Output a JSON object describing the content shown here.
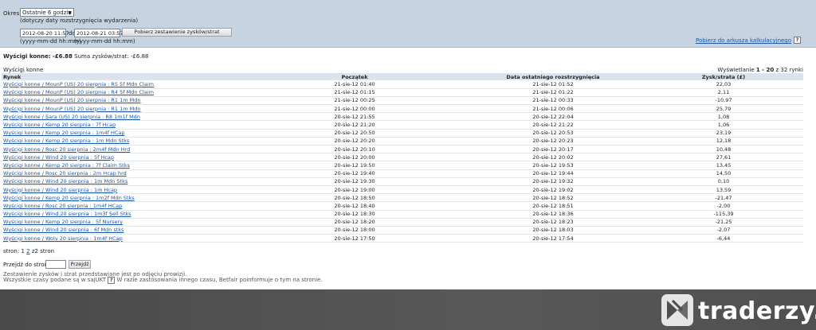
{
  "filter": {
    "period_label": "Okres:",
    "period_value": "Ostatnie 6 godzin",
    "period_note": "(dotyczy daty rozstrzygnięcia wydarzenia)",
    "from_value": "2012-08-20 11:57",
    "to_label": "do",
    "to_value": "2012-08-21 03:57",
    "format_hint_from": "(yyyy-mm-dd hh:mm)",
    "format_hint_to": "(yyyy-mm-dd hh:mm)",
    "fetch_button": "Pobierz zestawienie zysków/strat",
    "download_link": "Pobierz do arkusza kalkulacyjnego",
    "help": "?"
  },
  "summary": {
    "title": "Wyścigi konne:",
    "total": "-£6.88",
    "sum_label": "Suma zysków/strat:",
    "sum_value": "-£6.88"
  },
  "section": {
    "name": "Wyścigi konne",
    "showing_prefix": "Wyświetlanie",
    "showing_range": "1 - 20",
    "showing_suffix": "z 32 rynki"
  },
  "table": {
    "headers": {
      "market": "Rynek",
      "start": "Początek",
      "settled": "Data ostatniego rozstrzygnięcia",
      "pl": "Zysk/strata (£)"
    },
    "rows": [
      {
        "market": "Wyścigi konne / MounP (US) 20 sierpnia : R5 5f Mdn Claim",
        "start": "21-sie-12 01:40",
        "settled": "21-sie-12 01:52",
        "pl": "22,03"
      },
      {
        "market": "Wyścigi konne / MounP (US) 20 sierpnia : R4 5f Mdn Claim",
        "start": "21-sie-12 01:15",
        "settled": "21-sie-12 01:22",
        "pl": "2,11"
      },
      {
        "market": "Wyścigi konne / MounP (US) 20 sierpnia : R1 1m Mdn",
        "start": "21-sie-12 00:25",
        "settled": "21-sie-12 00:33",
        "pl": "-10,97"
      },
      {
        "market": "Wyścigi konne / MounP (US) 20 sierpnia : R1 1m Mdn",
        "start": "21-sie-12 00:00",
        "settled": "21-sie-12 00:06",
        "pl": "25,79"
      },
      {
        "market": "Wyścigi konne / Sara (US) 20 sierpnia : R8 1m1f Mdn",
        "start": "20-sie-12 21:55",
        "settled": "20-sie-12 22:04",
        "pl": "1,08"
      },
      {
        "market": "Wyścigi konne / Kemp 20 sierpnia : 7f Hcap",
        "start": "20-sie-12 21:20",
        "settled": "20-sie-12 21:22",
        "pl": "1,06"
      },
      {
        "market": "Wyścigi konne / Kemp 20 sierpnia : 1m4f HCap",
        "start": "20-sie-12 20:50",
        "settled": "20-sie-12 20:53",
        "pl": "23,19"
      },
      {
        "market": "Wyścigi konne / Kemp 20 sierpnia : 1m Mdn Stks",
        "start": "20-sie-12 20:20",
        "settled": "20-sie-12 20:23",
        "pl": "12,18"
      },
      {
        "market": "Wyścigi konne / Rosc 20 sierpnia : 2m4f Mdn Hrd",
        "start": "20-sie-12 20:10",
        "settled": "20-sie-12 20:17",
        "pl": "10,48"
      },
      {
        "market": "Wyścigi konne / Wind 20 sierpnia : 5f Hcap",
        "start": "20-sie-12 20:00",
        "settled": "20-sie-12 20:02",
        "pl": "27,61"
      },
      {
        "market": "Wyścigi konne / Kemp 20 sierpnia : 7f Claim Stks",
        "start": "20-sie-12 19:50",
        "settled": "20-sie-12 19:53",
        "pl": "13,45"
      },
      {
        "market": "Wyścigi konne / Rosc 20 sierpnia : 2m Hcap hrd",
        "start": "20-sie-12 19:40",
        "settled": "20-sie-12 19:44",
        "pl": "14,50"
      },
      {
        "market": "Wyścigi konne / Wind 20 sierpnia : 1m Mdn Stks",
        "start": "20-sie-12 19:30",
        "settled": "20-sie-12 19:32",
        "pl": "0,10"
      },
      {
        "market": "Wyścigi konne / Wind 20 sierpnia : 1m Hcap",
        "start": "20-sie-12 19:00",
        "settled": "20-sie-12 19:02",
        "pl": "13,59"
      },
      {
        "market": "Wyścigi konne / Kemp 20 sierpnia : 1m2f Mdn Stks",
        "start": "20-sie-12 18:50",
        "settled": "20-sie-12 18:52",
        "pl": "-21,47"
      },
      {
        "market": "Wyścigi konne / Rosc 20 sierpnia : 1m4f HCap",
        "start": "20-sie-12 18:40",
        "settled": "20-sie-12 18:51",
        "pl": "-2,00"
      },
      {
        "market": "Wyścigi konne / Wind 20 sierpnia : 1m3f Sell Stks",
        "start": "20-sie-12 18:30",
        "settled": "20-sie-12 18:36",
        "pl": "-115,39"
      },
      {
        "market": "Wyścigi konne / Kemp 20 sierpnia : 5f Nursery",
        "start": "20-sie-12 18:20",
        "settled": "20-sie-12 18:23",
        "pl": "-21,25"
      },
      {
        "market": "Wyścigi konne / Wind 20 sierpnia : 6f Mdn stks",
        "start": "20-sie-12 18:00",
        "settled": "20-sie-12 18:03",
        "pl": "-2,07"
      },
      {
        "market": "Wyścigi konne / Wolv 20 sierpnia : 1m4f HCap",
        "start": "20-sie-12 17:50",
        "settled": "20-sie-12 17:54",
        "pl": "-6,44"
      }
    ]
  },
  "pagination": {
    "label": "stron:",
    "current": "1",
    "next": "2",
    "suffix": "z2 stron",
    "goto_label": "Przejdź do strony:",
    "goto_value": "",
    "goto_button": "Przejdź"
  },
  "notes": {
    "line1": "Zestawienie zysków i strat przedstawiane jest po odjęciu prowizji.",
    "line2_a": "Wszystkie czasy podane są w sajUKT",
    "line2_b": "W razie zastosowania innego czasu, Betfair poinformuje o tym na stronie."
  },
  "watermark": {
    "text": "traderzy.pl",
    "icon": "traderzy-logo-icon"
  },
  "colors": {
    "filter_panel": "#c6d3e0",
    "header_row": "#dbe4ec",
    "link": "#1c56a6",
    "footer": "#4e4e4e"
  }
}
